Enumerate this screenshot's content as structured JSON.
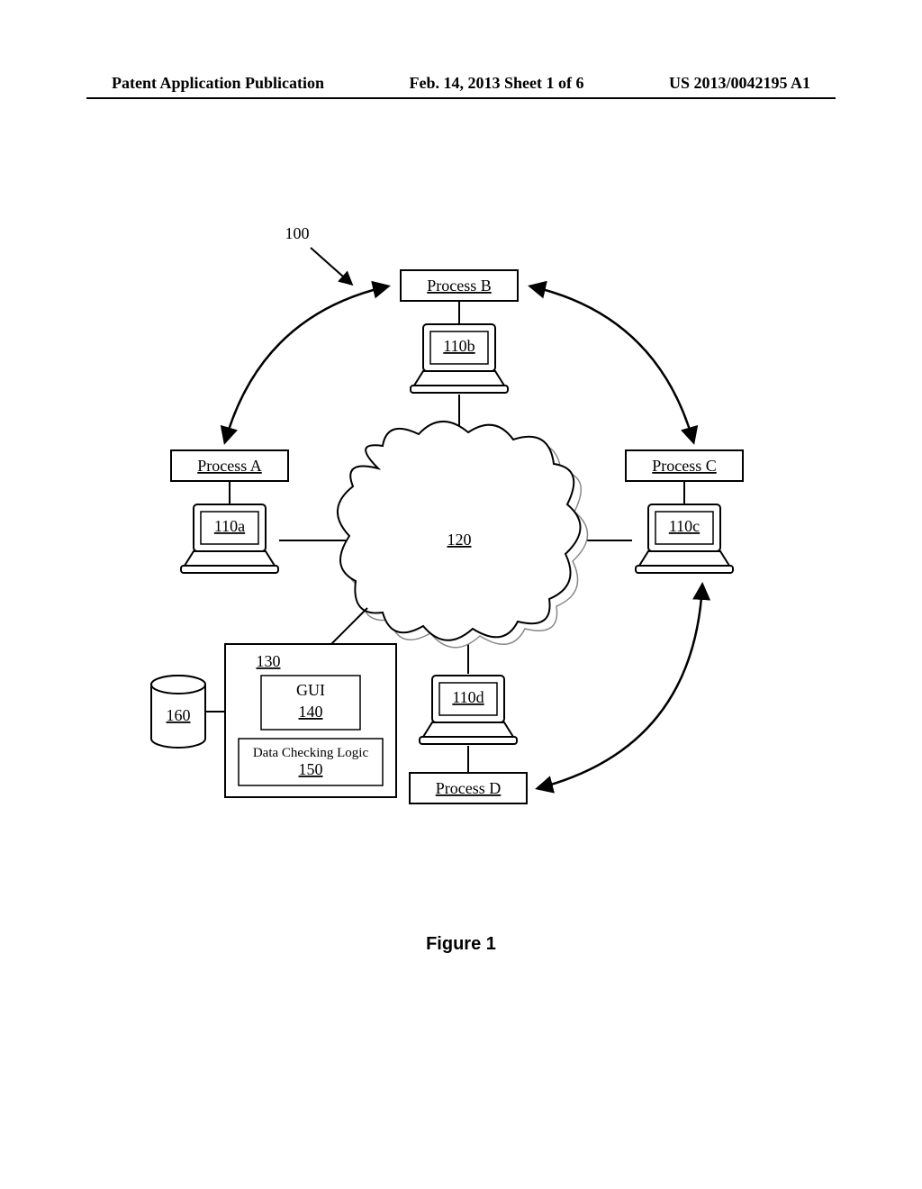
{
  "header": {
    "left": "Patent Application Publication",
    "center": "Feb. 14, 2013  Sheet 1 of 6",
    "right": "US 2013/0042195 A1"
  },
  "figure": {
    "caption": "Figure 1",
    "system_ref": "100",
    "cloud_ref": "120",
    "processes": {
      "a": {
        "label": "Process A",
        "ref": "110a"
      },
      "b": {
        "label": "Process B",
        "ref": "110b"
      },
      "c": {
        "label": "Process C",
        "ref": "110c"
      },
      "d": {
        "label": "Process D",
        "ref": "110d"
      }
    },
    "server": {
      "ref": "130",
      "gui_label": "GUI",
      "gui_ref": "140",
      "logic_label": "Data Checking Logic",
      "logic_ref": "150"
    },
    "db_ref": "160"
  }
}
